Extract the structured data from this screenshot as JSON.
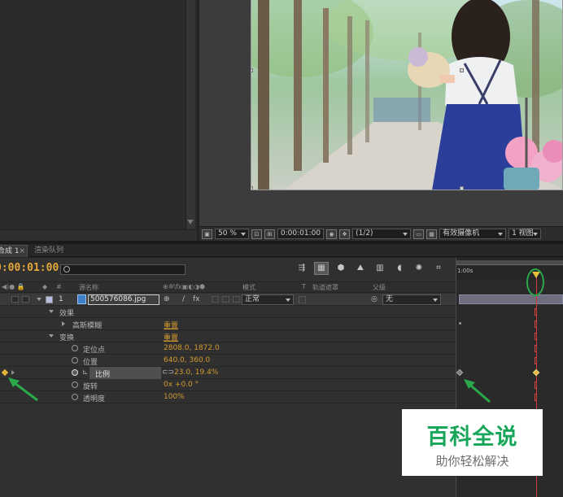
{
  "viewer": {
    "zoom": "50 %",
    "timecode": "0:00:01:00",
    "resolution": "(1/2)",
    "camera": "有效摄像机",
    "views": "1 视图"
  },
  "tabs": {
    "comp": "合成 1",
    "close": "×",
    "render": "渲染队列"
  },
  "timeline": {
    "timecode": "0:00:01:00",
    "ruler_start": "1:00s"
  },
  "columns": {
    "num": "#",
    "source": "源名称",
    "mode": "模式",
    "t": "T",
    "trkmat": "轨道遮罩",
    "parent": "父级"
  },
  "layer": {
    "index": "1",
    "name": "500576086.jpg",
    "mode": "正常",
    "parent": "无"
  },
  "rows": {
    "effects": "效果",
    "blur": "高斯模糊",
    "blur_reset": "重置",
    "transform": "变换",
    "transform_reset": "重置",
    "anchor": "定位点",
    "anchor_value": "2808.0, 1872.0",
    "position": "位置",
    "position_value": "640.0, 360.0",
    "scale": "比例",
    "scale_value": "23.0, 19.4%",
    "rotation": "旋转",
    "rotation_value": "0x +0.0 °",
    "opacity": "透明度",
    "opacity_value": "100%"
  },
  "watermark": {
    "title": "百科全说",
    "subtitle": "助你轻松解决"
  },
  "colors": {
    "accent_orange": "#d49a2e",
    "cti_red": "#d23a3a",
    "highlight_green": "#2aa84a",
    "brand_green": "#18a65a"
  }
}
